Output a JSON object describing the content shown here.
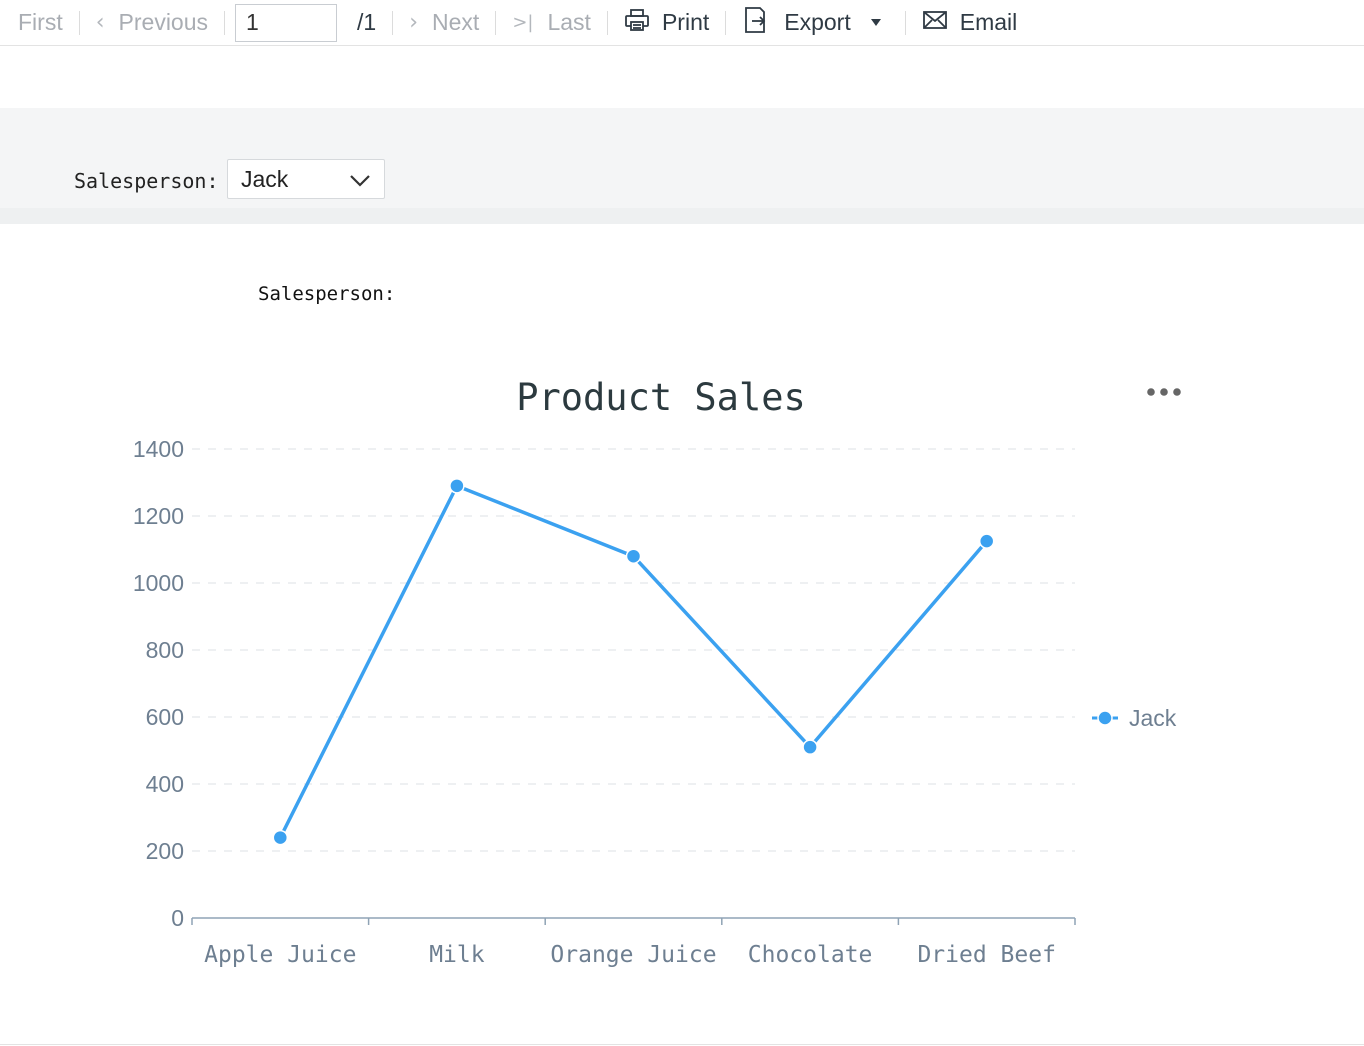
{
  "toolbar": {
    "first_label": "First",
    "previous_label": "Previous",
    "page_value": "1",
    "page_total": "/1",
    "next_label": "Next",
    "last_label": "Last",
    "print_label": "Print",
    "export_label": "Export",
    "email_label": "Email"
  },
  "parameters": {
    "salesperson_label": "Salesperson:",
    "salesperson_value": "Jack"
  },
  "report": {
    "salesperson_label": "Salesperson:"
  },
  "chart_data": {
    "type": "line",
    "title": "Product Sales",
    "categories": [
      "Apple Juice",
      "Milk",
      "Orange Juice",
      "Chocolate",
      "Dried Beef"
    ],
    "series": [
      {
        "name": "Jack",
        "values": [
          240,
          1290,
          1080,
          510,
          1125
        ],
        "color": "#3ba1f0"
      }
    ],
    "ylim": [
      0,
      1400
    ],
    "yticks": [
      0,
      200,
      400,
      600,
      800,
      1000,
      1200,
      1400
    ],
    "xlabel": "",
    "ylabel": "",
    "grid": true,
    "legend": "right",
    "menu_icon": "more-horizontal-icon"
  }
}
